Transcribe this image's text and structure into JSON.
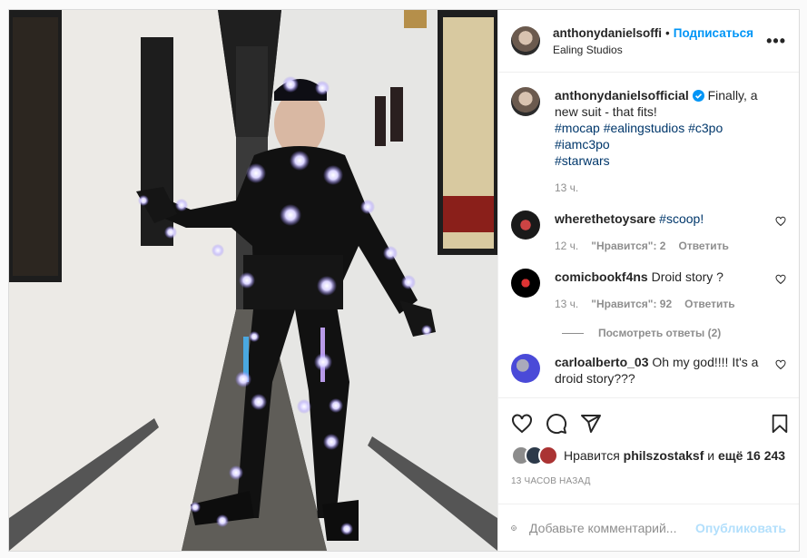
{
  "header": {
    "username": "anthonydanielsoffi",
    "separator": "•",
    "follow_label": "Подписаться",
    "location": "Ealing Studios",
    "more_icon": "more-horizontal-icon"
  },
  "caption": {
    "username": "anthonydanielsofficial",
    "verified_icon": "verified-badge-icon",
    "text": "Finally, a new suit - that fits!",
    "hashtags_line1": "#mocap #ealingstudios #c3po #iamc3po",
    "hashtags_line2": "#starwars",
    "time": "13 ч."
  },
  "comments": [
    {
      "username": "wherethetoysare",
      "text": "#scoop!",
      "time": "12 ч.",
      "likes": "\"Нравится\": 2",
      "reply": "Ответить"
    },
    {
      "username": "comicbookf4ns",
      "text": "Droid story ?",
      "time": "13 ч.",
      "likes": "\"Нравится\": 92",
      "reply": "Ответить",
      "view_replies": "Посмотреть ответы (2)"
    },
    {
      "username": "carloalberto_03",
      "text": "Oh my god!!!! It's a droid story???"
    }
  ],
  "actions": {
    "like_icon": "heart-icon",
    "comment_icon": "comment-icon",
    "share_icon": "send-icon",
    "save_icon": "bookmark-icon"
  },
  "likes": {
    "prefix": "Нравится",
    "user": "philszostaksf",
    "conj": "и",
    "others": "ещё 16 243"
  },
  "posted": "13 часов назад",
  "add_comment": {
    "placeholder": "Добавьте комментарий...",
    "publish_label": "Опубликовать",
    "emoji_icon": "emoji-icon"
  },
  "colors": {
    "accent": "#0095f6",
    "link": "#00376b",
    "muted": "#8e8e8e",
    "publish_disabled": "#b2dffc",
    "marker": "#8f7bff"
  }
}
